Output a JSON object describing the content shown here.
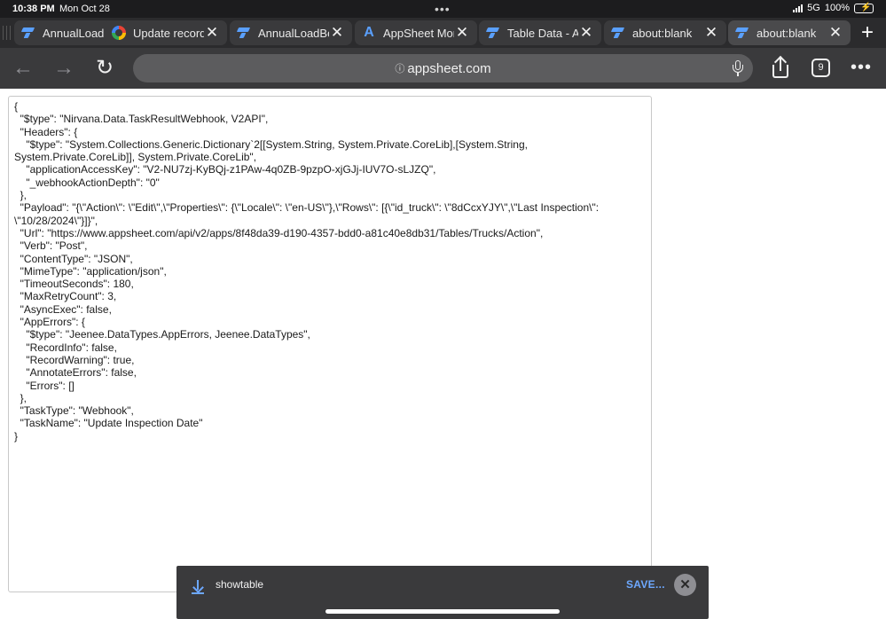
{
  "status": {
    "time": "10:38 PM",
    "date": "Mon Oct 28",
    "network": "5G",
    "battery": "100%"
  },
  "tabs": [
    {
      "label": "AnnualLoadBookSetup",
      "favicon": "appsheet-icon",
      "active": false
    },
    {
      "label": "Update records",
      "favicon": "google-icon",
      "active": false
    },
    {
      "label": "AnnualLoadBookSetup",
      "favicon": "appsheet-icon",
      "active": false
    },
    {
      "label": "AppSheet Monitor",
      "favicon": "appsheet-a-icon",
      "active": false
    },
    {
      "label": "Table Data - AppSheet",
      "favicon": "appsheet-icon",
      "active": false
    },
    {
      "label": "about:blank",
      "favicon": "appsheet-icon",
      "active": false
    },
    {
      "label": "about:blank",
      "favicon": "appsheet-icon",
      "active": true
    }
  ],
  "toolbar": {
    "url": "appsheet.com",
    "tab_count": "9"
  },
  "json_text": "{\n  \"$type\": \"Nirvana.Data.TaskResultWebhook, V2API\",\n  \"Headers\": {\n    \"$type\": \"System.Collections.Generic.Dictionary`2[[System.String, System.Private.CoreLib],[System.String,\nSystem.Private.CoreLib]], System.Private.CoreLib\",\n    \"applicationAccessKey\": \"V2-NU7zj-KyBQj-z1PAw-4q0ZB-9pzpO-xjGJj-IUV7O-sLJZQ\",\n    \"_webhookActionDepth\": \"0\"\n  },\n  \"Payload\": \"{\\\"Action\\\": \\\"Edit\\\",\\\"Properties\\\": {\\\"Locale\\\": \\\"en-US\\\"},\\\"Rows\\\": [{\\\"id_truck\\\": \\\"8dCcxYJY\\\",\\\"Last Inspection\\\":\n\\\"10/28/2024\\\"}]}\",\n  \"Url\": \"https://www.appsheet.com/api/v2/apps/8f48da39-d190-4357-bdd0-a81c40e8db31/Tables/Trucks/Action\",\n  \"Verb\": \"Post\",\n  \"ContentType\": \"JSON\",\n  \"MimeType\": \"application/json\",\n  \"TimeoutSeconds\": 180,\n  \"MaxRetryCount\": 3,\n  \"AsyncExec\": false,\n  \"AppErrors\": {\n    \"$type\": \"Jeenee.DataTypes.AppErrors, Jeenee.DataTypes\",\n    \"RecordInfo\": false,\n    \"RecordWarning\": true,\n    \"AnnotateErrors\": false,\n    \"Errors\": []\n  },\n  \"TaskType\": \"Webhook\",\n  \"TaskName\": \"Update Inspection Date\"\n}",
  "download": {
    "filename": "showtable",
    "save_label": "SAVE..."
  },
  "colors": {
    "accent": "#6da8ff",
    "chrome_dark": "#2b2b2d",
    "toolbar": "#3a3a3c"
  }
}
